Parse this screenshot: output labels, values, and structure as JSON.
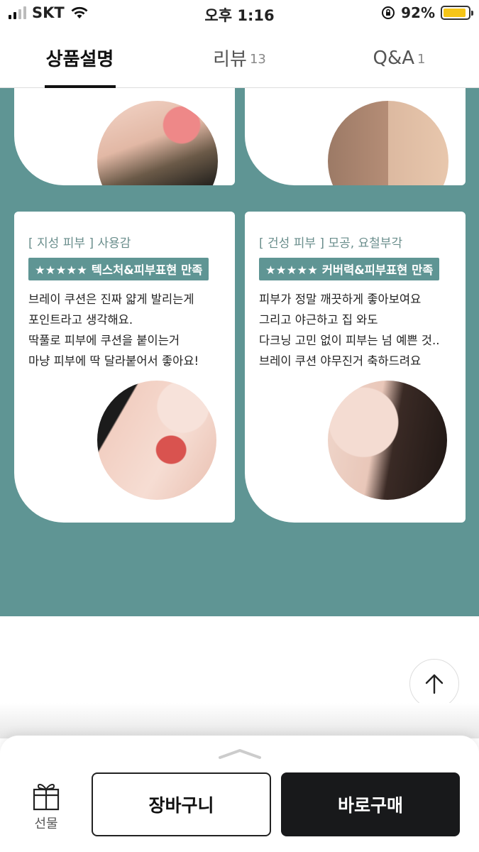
{
  "status_bar": {
    "carrier": "SKT",
    "time": "오후 1:16",
    "battery": "92%",
    "battery_level": 0.92
  },
  "tabs": [
    {
      "label": "상품설명",
      "count": ""
    },
    {
      "label": "리뷰",
      "count": "13"
    },
    {
      "label": "Q&A",
      "count": "1"
    }
  ],
  "cards": [
    {
      "tag": "[ 지성 피부 ] 사용감",
      "badge": "★★★★★ 텍스처&피부표현 만족",
      "lines": [
        "브레이 쿠션은 진짜 얇게 발리는게",
        "포인트라고 생각해요.",
        "딱풀로 피부에 쿠션을 붙이는거",
        "마냥 피부에 딱 달라붙어서 좋아요!"
      ]
    },
    {
      "tag": "[ 건성 피부 ] 모공, 요철부각",
      "badge": "★★★★★ 커버력&피부표현 만족",
      "lines": [
        "피부가 정말 깨끗하게 좋아보여요",
        "그리고 야근하고 집 와도",
        "다크닝 고민 없이 피부는 넘 예쁜 것..",
        "브레이 쿠션 야무진거 축하드려요"
      ]
    }
  ],
  "bottom": {
    "gift_label": "선물",
    "cart_label": "장바구니",
    "buy_label": "바로구매"
  },
  "colors": {
    "teal": "#5f9594",
    "buy_button": "#18191b",
    "battery": "#f5c518"
  }
}
